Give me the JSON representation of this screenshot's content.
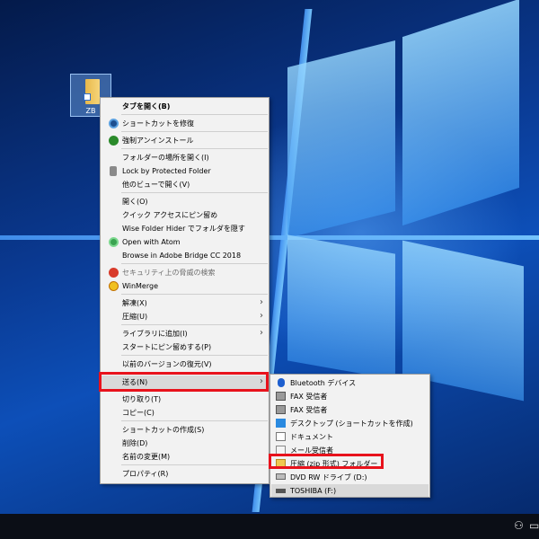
{
  "desktop": {
    "icon_label": "ZB"
  },
  "context_menu": {
    "items": [
      {
        "label": "タブを開く(B)"
      },
      {
        "label": "ショートカットを修復"
      },
      {
        "label": "強制アンインストール"
      },
      {
        "label": "フォルダーの場所を開く(I)"
      },
      {
        "label": "Lock by Protected Folder"
      },
      {
        "label": "他のビューで開く(V)"
      },
      {
        "label": "開く(O)"
      },
      {
        "label": "クイック アクセスにピン留め"
      },
      {
        "label": "Wise Folder Hider でフォルダを隠す"
      },
      {
        "label": "Open with Atom"
      },
      {
        "label": "Browse in Adobe Bridge CC 2018"
      },
      {
        "label": "セキュリティ上の脅威の検索"
      },
      {
        "label": "WinMerge"
      },
      {
        "label": "解凍(X)"
      },
      {
        "label": "圧縮(U)"
      },
      {
        "label": "ライブラリに追加(I)"
      },
      {
        "label": "スタートにピン留めする(P)"
      },
      {
        "label": "以前のバージョンの復元(V)"
      },
      {
        "label": "送る(N)"
      },
      {
        "label": "切り取り(T)"
      },
      {
        "label": "コピー(C)"
      },
      {
        "label": "ショートカットの作成(S)"
      },
      {
        "label": "削除(D)"
      },
      {
        "label": "名前の変更(M)"
      },
      {
        "label": "プロパティ(R)"
      }
    ]
  },
  "send_to_menu": {
    "items": [
      {
        "label": "Bluetooth デバイス",
        "icon": "bluetooth-icon"
      },
      {
        "label": "FAX 受信者",
        "icon": "fax-icon"
      },
      {
        "label": "FAX 受信者",
        "icon": "fax-icon"
      },
      {
        "label": "デスクトップ (ショートカットを作成)",
        "icon": "desktop-icon"
      },
      {
        "label": "ドキュメント",
        "icon": "document-icon"
      },
      {
        "label": "メール受信者",
        "icon": "mail-icon"
      },
      {
        "label": "圧縮 (zip 形式) フォルダー",
        "icon": "zip-folder-icon"
      },
      {
        "label": "DVD RW ドライブ (D:)",
        "icon": "dvd-drive-icon"
      },
      {
        "label": "TOSHIBA (F:)",
        "icon": "usb-drive-icon"
      }
    ]
  },
  "colors": {
    "highlight_box": "#e8121c",
    "menu_bg": "#f2f2f2",
    "menu_hover": "#d9d9d9"
  }
}
